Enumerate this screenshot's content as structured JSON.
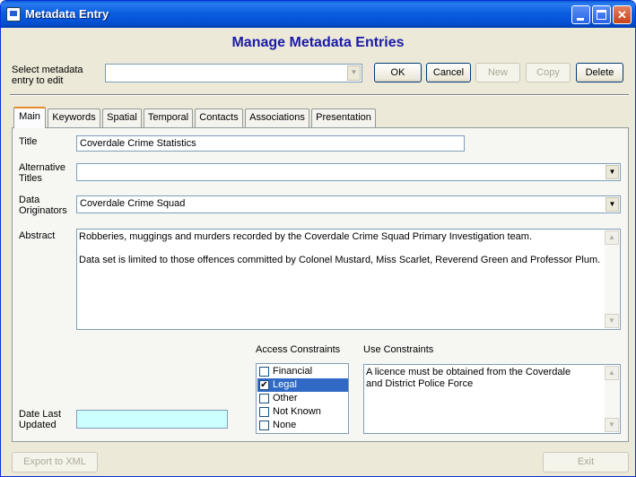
{
  "window": {
    "title": "Metadata Entry",
    "buttons": {
      "minimize": "_",
      "maximize": "□",
      "close": "✕"
    }
  },
  "header": {
    "title": "Manage Metadata Entries"
  },
  "select_entry": {
    "label_line1": "Select metadata",
    "label_line2": "entry to edit",
    "value": "",
    "dropdown_arrow": "▼"
  },
  "actions": {
    "ok": "OK",
    "cancel": "Cancel",
    "new": "New",
    "copy": "Copy",
    "delete": "Delete"
  },
  "tabs": [
    {
      "label": "Main",
      "active": true
    },
    {
      "label": "Keywords"
    },
    {
      "label": "Spatial"
    },
    {
      "label": "Temporal"
    },
    {
      "label": "Contacts"
    },
    {
      "label": "Associations"
    },
    {
      "label": "Presentation"
    }
  ],
  "main": {
    "title": {
      "label": "Title",
      "value": "Coverdale Crime Statistics"
    },
    "alternative_titles": {
      "label_line1": "Alternative",
      "label_line2": "Titles",
      "value": ""
    },
    "data_originators": {
      "label_line1": "Data",
      "label_line2": "Originators",
      "value": "Coverdale Crime Squad"
    },
    "abstract": {
      "label": "Abstract",
      "line1": "Robberies, muggings and murders recorded by the Coverdale Crime Squad Primary Investigation team.",
      "line2": "Data set is limited to those offences committed by Colonel Mustard, Miss Scarlet, Reverend Green and Professor Plum."
    },
    "access_constraints": {
      "label": "Access Constraints",
      "options": [
        {
          "label": "Financial",
          "checked": false
        },
        {
          "label": "Legal",
          "checked": true
        },
        {
          "label": "Other",
          "checked": false
        },
        {
          "label": "Not Known",
          "checked": false
        },
        {
          "label": "None",
          "checked": false
        }
      ],
      "check_mark": "✔"
    },
    "use_constraints": {
      "label": "Use Constraints",
      "line1": "A licence must be obtained from the Coverdale",
      "line2": "and District Police Force"
    },
    "date_last_updated": {
      "label_line1": "Date Last",
      "label_line2": "Updated",
      "value": ""
    }
  },
  "footer": {
    "export": "Export to XML",
    "exit": "Exit"
  },
  "scroll_arrows": {
    "up": "▲",
    "down": "▼"
  }
}
